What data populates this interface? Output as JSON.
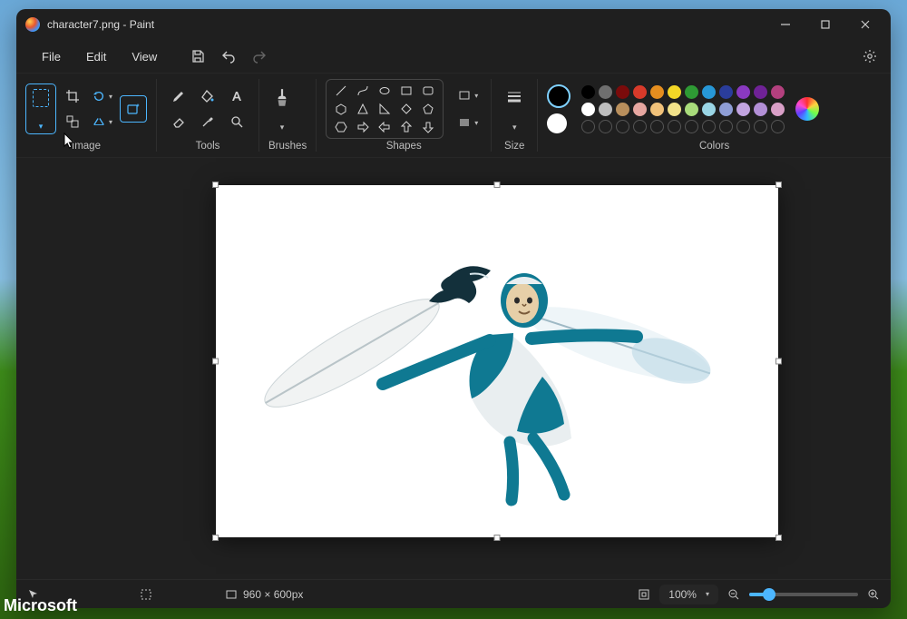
{
  "window": {
    "title": "character7.png - Paint"
  },
  "menu": {
    "file": "File",
    "edit": "Edit",
    "view": "View"
  },
  "ribbon": {
    "image_label": "Image",
    "tools_label": "Tools",
    "brushes_label": "Brushes",
    "shapes_label": "Shapes",
    "size_label": "Size",
    "colors_label": "Colors"
  },
  "colors": {
    "row1": [
      "#000000",
      "#6f6f6f",
      "#7b0b0b",
      "#d83a2a",
      "#e58e1f",
      "#f4d726",
      "#2e9a34",
      "#2797d6",
      "#2a3d9b",
      "#8a39c1",
      "#6f2296",
      "#b3407e"
    ],
    "row2": [
      "#ffffff",
      "#bdbdbd",
      "#b98f5c",
      "#e6a6a0",
      "#f1c27a",
      "#f2e28a",
      "#a9dc7b",
      "#9ad5e5",
      "#8f9ed6",
      "#c2a4e0",
      "#b28fd6",
      "#d99fc7"
    ]
  },
  "status": {
    "size_text": "960 × 600px",
    "zoom": "100%"
  },
  "watermark": "Microsoft"
}
